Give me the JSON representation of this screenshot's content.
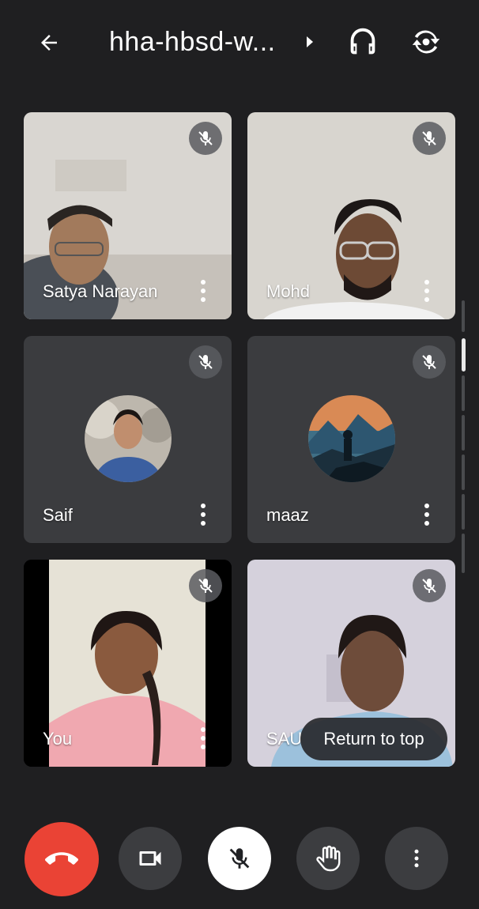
{
  "header": {
    "meeting_title": "hha-hbsd-w..."
  },
  "participants": [
    {
      "name": "Satya Narayan"
    },
    {
      "name": "Mohd"
    },
    {
      "name": "Saif"
    },
    {
      "name": "maaz"
    },
    {
      "name": "You"
    },
    {
      "name": "SAU"
    }
  ],
  "overlay": {
    "return_to_top": "Return to top"
  },
  "colors": {
    "background": "#1f1f21",
    "tile": "#3b3c3f",
    "end_call": "#ea4335",
    "control": "#3c3d40"
  }
}
